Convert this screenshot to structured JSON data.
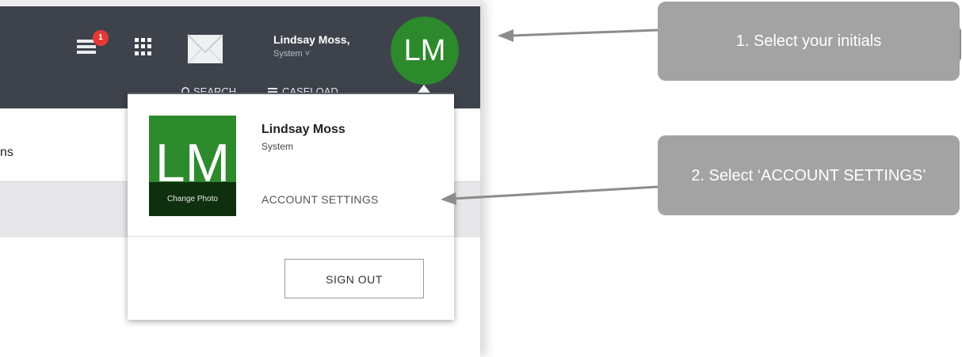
{
  "header": {
    "notification_count": "1",
    "user_name": "Lindsay Moss,",
    "user_role": "System ˅",
    "avatar_initials": "LM",
    "nav": {
      "search_label": "SEARCH",
      "caseload_label": "CASELOAD"
    },
    "icons": [
      "notifications-icon",
      "apps-grid-icon",
      "mail-icon",
      "search-icon",
      "menu-lines-icon"
    ]
  },
  "content": {
    "partial_tab_label": "ns"
  },
  "dropdown": {
    "photo_initials": "LM",
    "change_photo_label": "Change Photo",
    "name": "Lindsay Moss",
    "role": "System",
    "account_settings_label": "ACCOUNT SETTINGS",
    "sign_out_label": "SIGN OUT"
  },
  "callouts": {
    "step1": "1. Select your initials",
    "step2": "2. Select ‘ACCOUNT SETTINGS’"
  },
  "colors": {
    "header_bg": "#3e434b",
    "avatar_green": "#2c8a2c",
    "badge_red": "#e53935",
    "callout_gray": "#a3a3a3"
  }
}
